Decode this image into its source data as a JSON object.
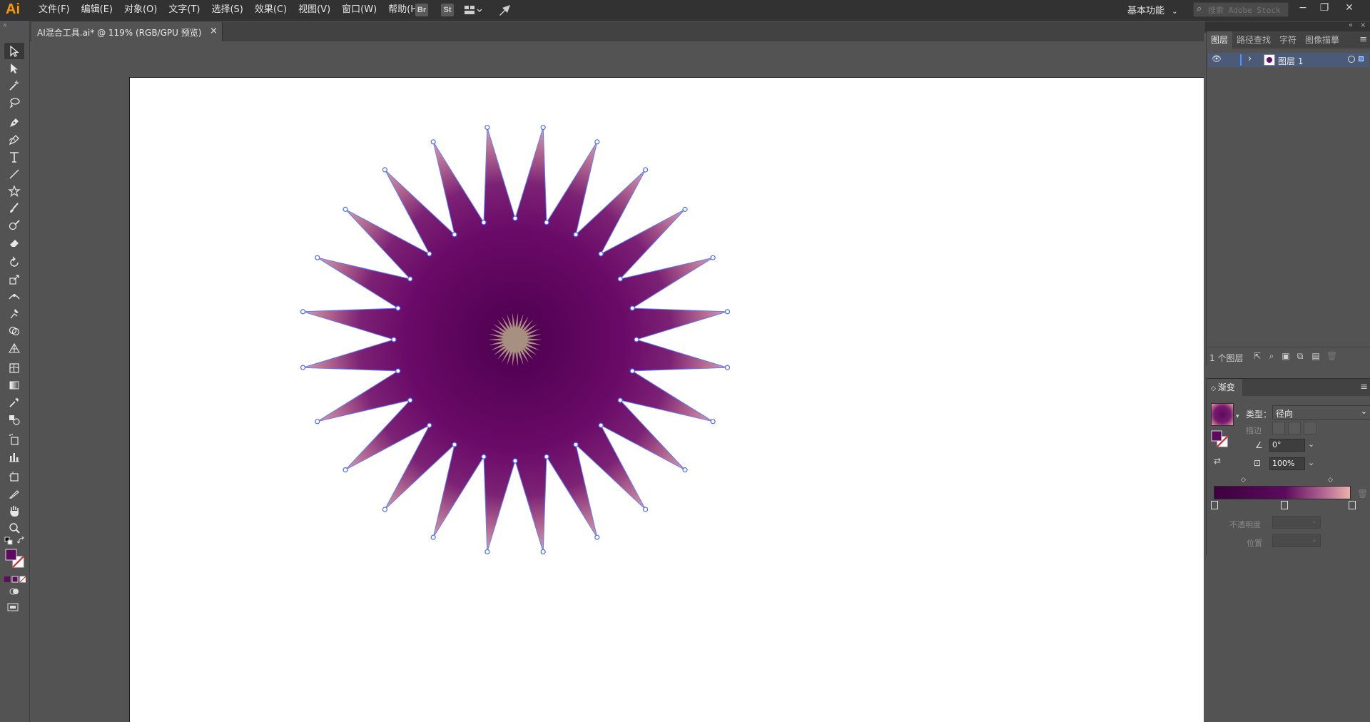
{
  "app": {
    "logo": "Ai",
    "accent": "#ff9a00"
  },
  "menu": [
    "文件(F)",
    "编辑(E)",
    "对象(O)",
    "文字(T)",
    "选择(S)",
    "效果(C)",
    "视图(V)",
    "窗口(W)",
    "帮助(H)"
  ],
  "menubar_icons": {
    "bridge": "Br",
    "stock": "St"
  },
  "workspace": {
    "label": "基本功能"
  },
  "search": {
    "placeholder": "搜索 Adobe Stock"
  },
  "window_controls": {
    "minimize": "−",
    "restore": "❐",
    "close": "✕"
  },
  "document_tab": {
    "title": "AI混合工具.ai* @ 119% (RGB/GPU 预览)",
    "close": "×"
  },
  "layers_panel": {
    "tabs": [
      "图层",
      "路径查找",
      "字符",
      "图像描摹"
    ],
    "active_tab": "图层",
    "layer": {
      "name": "图层 1",
      "color": "#4f8fff"
    },
    "footer_count": "1 个图层"
  },
  "gradient_panel": {
    "title": "渐变",
    "type_label": "类型：",
    "type_value": "径向",
    "stroke_label": "描边",
    "angle": "0°",
    "aspect": "100%",
    "opacity_label": "不透明度",
    "location_label": "位置",
    "stops": [
      "#3d003f",
      "#5a0c5c",
      "#eab2ac"
    ]
  },
  "artwork": {
    "description_colors": {
      "center": "#4c004e",
      "mid": "#6a0a68",
      "tip": "#e3a3a5",
      "inner_star": "#a89080"
    }
  }
}
